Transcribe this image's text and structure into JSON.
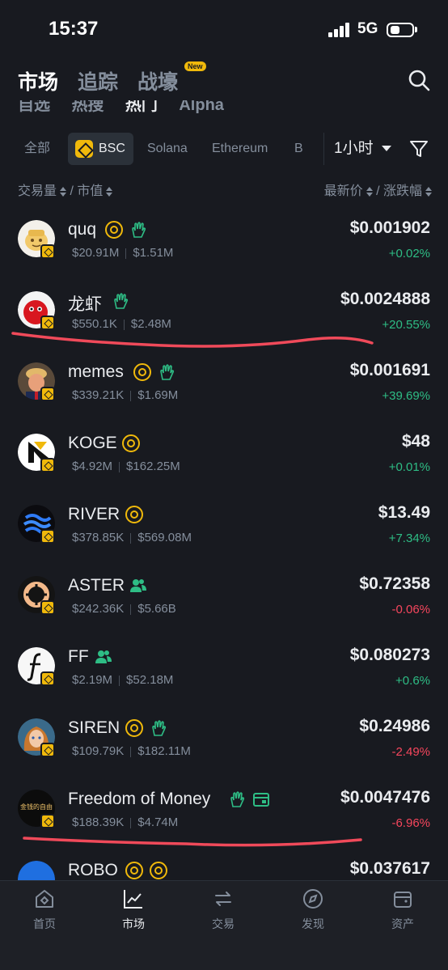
{
  "status_bar": {
    "time": "15:37",
    "network": "5G"
  },
  "main_tabs": [
    {
      "label": "市场",
      "active": true
    },
    {
      "label": "追踪",
      "active": false
    },
    {
      "label": "战壕",
      "active": false,
      "badge": "New"
    }
  ],
  "sub_tabs": [
    {
      "label": "自选"
    },
    {
      "label": "热搜"
    },
    {
      "label": "热门",
      "active": true
    },
    {
      "label": "Alpha"
    }
  ],
  "chains": [
    {
      "label": "全部"
    },
    {
      "label": "BSC",
      "active": true
    },
    {
      "label": "Solana"
    },
    {
      "label": "Ethereum"
    },
    {
      "label": "B"
    }
  ],
  "time_filter": "1小时",
  "columns": {
    "left_a": "交易量",
    "left_sep": "/",
    "left_b": "市值",
    "right_a": "最新价",
    "right_sep": "/",
    "right_b": "涨跌幅"
  },
  "tokens": [
    {
      "name": "quq",
      "volume": "$20.91M",
      "mcap": "$1.51M",
      "price": "$0.001902",
      "change": "+0.02%",
      "direction": "up",
      "tags": [
        "at-icon",
        "hand-icon"
      ]
    },
    {
      "name": "龙虾",
      "volume": "$550.1K",
      "mcap": "$2.48M",
      "price": "$0.0024888",
      "change": "+20.55%",
      "direction": "up",
      "tags": [
        "hand-icon"
      ]
    },
    {
      "name": "memes",
      "volume": "$339.21K",
      "mcap": "$1.69M",
      "price": "$0.001691",
      "change": "+39.69%",
      "direction": "up",
      "tags": [
        "at-icon",
        "hand-icon"
      ]
    },
    {
      "name": "KOGE",
      "volume": "$4.92M",
      "mcap": "$162.25M",
      "price": "$48",
      "change": "+0.01%",
      "direction": "up",
      "tags": [
        "at-icon"
      ]
    },
    {
      "name": "RIVER",
      "volume": "$378.85K",
      "mcap": "$569.08M",
      "price": "$13.49",
      "change": "+7.34%",
      "direction": "up",
      "tags": [
        "at-icon"
      ]
    },
    {
      "name": "ASTER",
      "volume": "$242.36K",
      "mcap": "$5.66B",
      "price": "$0.72358",
      "change": "-0.06%",
      "direction": "down",
      "tags": [
        "group-icon"
      ]
    },
    {
      "name": "FF",
      "volume": "$2.19M",
      "mcap": "$52.18M",
      "price": "$0.080273",
      "change": "+0.6%",
      "direction": "up",
      "tags": [
        "group-icon"
      ]
    },
    {
      "name": "SIREN",
      "volume": "$109.79K",
      "mcap": "$182.11M",
      "price": "$0.24986",
      "change": "-2.49%",
      "direction": "down",
      "tags": [
        "at-icon",
        "hand-icon"
      ]
    },
    {
      "name": "Freedom of Money",
      "volume": "$188.39K",
      "mcap": "$4.74M",
      "price": "$0.0047476",
      "change": "-6.96%",
      "direction": "down",
      "tags": [
        "hand-icon",
        "card-icon"
      ],
      "avatar_text": "金钱的自由"
    },
    {
      "name": "ROBO",
      "volume": "",
      "mcap": "",
      "price": "$0.037617",
      "change": "",
      "direction": "up",
      "tags": [
        "at-icon",
        "v-icon"
      ]
    }
  ],
  "bottom_nav": [
    {
      "label": "首页",
      "icon": "home-icon"
    },
    {
      "label": "市场",
      "icon": "market-chart-icon",
      "active": true
    },
    {
      "label": "交易",
      "icon": "trade-swap-icon"
    },
    {
      "label": "发现",
      "icon": "discover-compass-icon"
    },
    {
      "label": "资产",
      "icon": "wallet-icon"
    }
  ],
  "colors": {
    "background": "#181a20",
    "accent": "#f0b90b",
    "up": "#2ebd85",
    "down": "#f6465d",
    "annotation": "#f04a5a"
  }
}
